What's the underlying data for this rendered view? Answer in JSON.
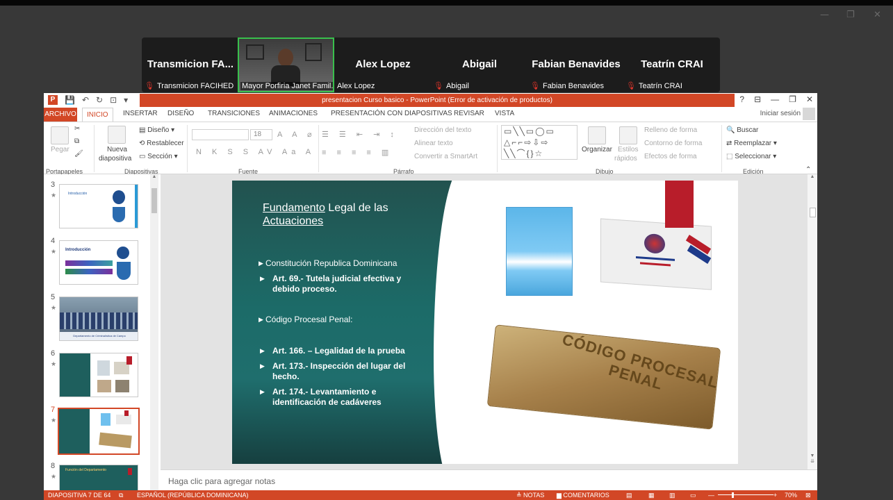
{
  "meeting": {
    "participants": [
      {
        "display": "Transmicion  FA...",
        "caption": "Transmicion FACIHED"
      },
      {
        "display": "",
        "caption": "Mayor Porfiria Janet Famil..."
      },
      {
        "display": "Alex Lopez",
        "caption": "Alex Lopez"
      },
      {
        "display": "Abigail",
        "caption": "Abigail"
      },
      {
        "display": "Fabian Benavides",
        "caption": "Fabian Benavides"
      },
      {
        "display": "Teatrín CRAI",
        "caption": "Teatrín CRAI"
      }
    ]
  },
  "app": {
    "title": "presentacion  Curso basico -  PowerPoint (Error de activación de productos)",
    "signin": "Iniciar sesión",
    "tabs": [
      "ARCHIVO",
      "INICIO",
      "INSERTAR",
      "DISEÑO",
      "TRANSICIONES",
      "ANIMACIONES",
      "PRESENTACIÓN CON DIAPOSITIVAS",
      "REVISAR",
      "VISTA"
    ]
  },
  "ribbon": {
    "paste": "Pegar",
    "new_slide_1": "Nueva",
    "new_slide_2": "diapositiva",
    "design": "Diseño",
    "reset": "Restablecer",
    "section": "Sección",
    "font_size": "18",
    "text_dir": "Dirección del texto",
    "align_text": "Alinear texto",
    "smartart": "Convertir a SmartArt",
    "organize": "Organizar",
    "styles_1": "Estilos",
    "styles_2": "rápidos",
    "fill": "Relleno de forma",
    "outline": "Contorno de forma",
    "effects": "Efectos de forma",
    "find": "Buscar",
    "replace": "Reemplazar",
    "select": "Seleccionar",
    "groups": {
      "clipboard": "Portapapeles",
      "slides": "Diapositivas",
      "font": "Fuente",
      "paragraph": "Párrafo",
      "drawing": "Dibujo",
      "editing": "Edición"
    }
  },
  "thumbnails": [
    {
      "num": "3",
      "star": "★",
      "title": "Introducción"
    },
    {
      "num": "4",
      "star": "★",
      "title": "Introducción"
    },
    {
      "num": "5",
      "star": "★",
      "title": "Departamento de Criminalística de Campo"
    },
    {
      "num": "6",
      "star": "★",
      "title": ""
    },
    {
      "num": "7",
      "star": "★",
      "title": ""
    },
    {
      "num": "8",
      "star": "★",
      "title": "Función del Departamento"
    }
  ],
  "slide": {
    "title_part1": "Fundamento",
    "title_part2": " Legal de las",
    "title_line2": "Actuaciones",
    "heading1": "Constitución Republica Dominicana",
    "item1_a": "Art. 69.- Tutela judicial efectiva y",
    "item1_b": "debido proceso.",
    "heading2": "Código Procesal Penal:",
    "item2": "Art. 166. – Legalidad de la prueba",
    "item3_a": "Art. 173.-   Inspección del lugar del",
    "item3_b": "hecho.",
    "item4_a": "Art. 174.-   Levantamiento e",
    "item4_b": "identificación de cadáveres",
    "book_text": "CÓDIGO PROCESAL PENAL"
  },
  "notes_placeholder": "Haga clic para agregar notas",
  "status": {
    "slide_count": "DIAPOSITIVA 7 DE 64",
    "language": "ESPAÑOL (REPÚBLICA DOMINICANA)",
    "notes": "NOTAS",
    "comments": "COMENTARIOS",
    "zoom": "70%"
  }
}
